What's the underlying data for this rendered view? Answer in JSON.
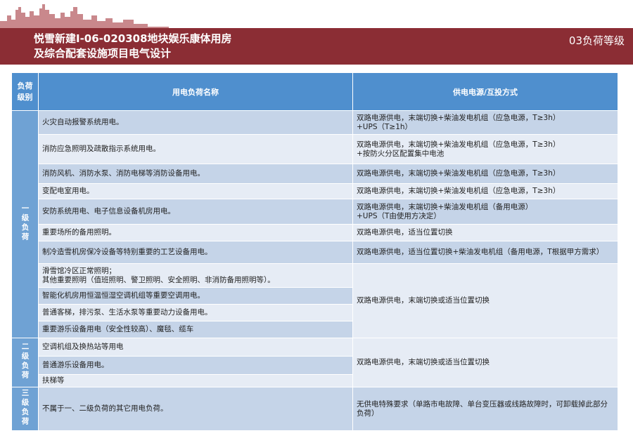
{
  "header": {
    "title": "悦雪新建I-06-020308地块娱乐康体用房\n及综合配套设施项目电气设计",
    "section": "03负荷等级"
  },
  "table": {
    "headers": [
      "负荷\n级别",
      "用电负荷名称",
      "供电电源/互投方式"
    ],
    "level1": "一级负荷",
    "level2": "二级负荷",
    "level3": "三级负荷",
    "rows1": [
      {
        "load": "火灾自动报警系统用电。",
        "supply": "双路电源供电，末端切换+柴油发电机组（应急电源，T≥3h）\n+UPS（T≥1h）"
      },
      {
        "load": "消防应急照明及疏散指示系统用电。",
        "supply": "双路电源供电，末端切换+柴油发电机组（应急电源，T≥3h）\n+按防火分区配置集中电池"
      },
      {
        "load": "消防风机、消防水泵、消防电梯等消防设备用电。",
        "supply": "双路电源供电，末端切换+柴油发电机组（应急电源，T≥3h）"
      },
      {
        "load": "变配电室用电。",
        "supply": "双路电源供电，末端切换+柴油发电机组（应急电源，T≥3h）"
      },
      {
        "load": "安防系统用电、电子信息设备机房用电。",
        "supply": "双路电源供电，末端切换+柴油发电机组（备用电源）\n+UPS（T由使用方决定）"
      },
      {
        "load": "重要场所的备用照明。",
        "supply": "双路电源供电，适当位置切换"
      },
      {
        "load": "制冷造雪机房保冷设备等特别重要的工艺设备用电。",
        "supply": "双路电源供电，适当位置切换+柴油发电机组（备用电源，T根据甲方需求）"
      }
    ],
    "rows1b": [
      "滑雪馆冷区正常照明；\n其他重要照明（值班照明、警卫照明、安全照明、非消防备用照明等）。",
      "智能化机房用恒温恒湿空调机组等重要空调用电。",
      "普通客梯，排污泵、生活水泵等重要动力设备用电。",
      "重要游乐设备用电（安全性较高）、魔毯、缆车"
    ],
    "supply1b": "双路电源供电，末端切换或适当位置切换",
    "rows2": [
      "空调机组及换热站等用电",
      "普通游乐设备用电。",
      "扶梯等"
    ],
    "supply2": "双路电源供电，末端切换或适当位置切换",
    "row3": {
      "load": "不属于一、二级负荷的其它用电负荷。",
      "supply": "无供电特殊要求（单路市电故障、单台变压器或线路故障时，可卸载掉此部分负荷）"
    }
  }
}
